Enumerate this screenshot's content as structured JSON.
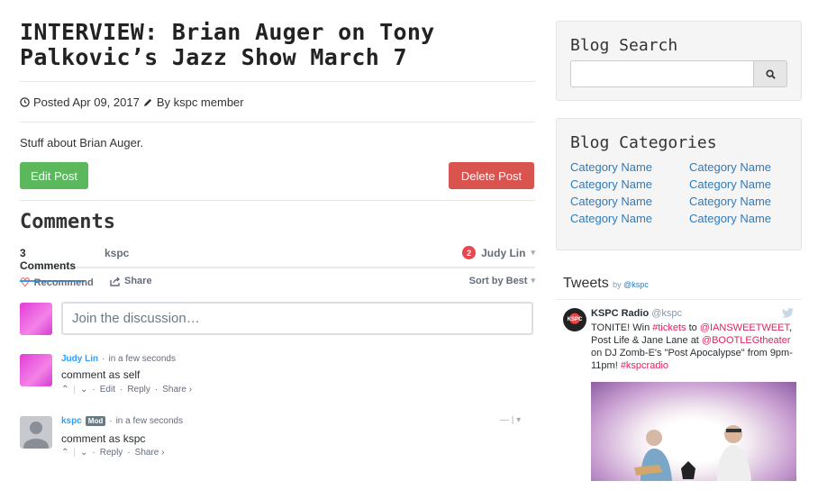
{
  "post": {
    "title": "INTERVIEW: Brian Auger on Tony Palkovic’s Jazz Show March 7",
    "posted": "Posted Apr 09, 2017",
    "author": "By kspc member",
    "body": "Stuff about Brian Auger.",
    "edit_label": "Edit Post",
    "delete_label": "Delete Post"
  },
  "comments": {
    "heading": "Comments",
    "tab_count": "3 Comments",
    "tab_site": "kspc",
    "notification_count": "2",
    "user_name": "Judy Lin",
    "recommend_label": "Recommend",
    "share_label": "Share",
    "sort_label": "Sort by Best",
    "composer_placeholder": "Join the discussion…",
    "items": [
      {
        "author": "Judy Lin",
        "time": "in a few seconds",
        "text": "comment as self",
        "edit": "Edit",
        "reply": "Reply",
        "share": "Share ›"
      },
      {
        "author": "kspc",
        "badge": "Mod",
        "time": "in a few seconds",
        "text": "comment as kspc",
        "reply": "Reply",
        "share": "Share ›"
      }
    ]
  },
  "sidebar": {
    "search_title": "Blog Search",
    "categories_title": "Blog Categories",
    "categories": [
      "Category Name",
      "Category Name",
      "Category Name",
      "Category Name",
      "Category Name",
      "Category Name",
      "Category Name",
      "Category Name"
    ]
  },
  "tweets": {
    "title": "Tweets",
    "by_prefix": "by",
    "by_handle": "@kspc",
    "tweet": {
      "name": "KSPC Radio",
      "handle": "@kspc",
      "avatar_text": "KSPC",
      "t1": "TONITE! Win ",
      "l1": "#tickets",
      "t2": " to ",
      "l2": "@IANSWEETWEET",
      "t3": ", Post Life & Jane Lane at ",
      "l3": "@BOOTLEGtheater",
      "t4": " on DJ Zomb-E's \"Post Apocalypse\" from 9pm-11pm! ",
      "l4": "#kspcradio"
    }
  },
  "colors": {
    "edit_green": "#5cb85c",
    "delete_red": "#d9534f",
    "disqus_blue": "#2e9fff",
    "link_blue": "#337ab7",
    "twitter_pink": "#e0245e"
  }
}
